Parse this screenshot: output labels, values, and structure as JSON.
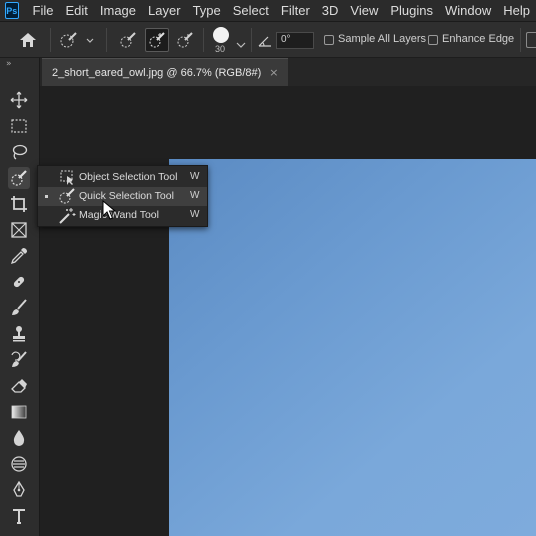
{
  "app": {
    "logo": "Ps"
  },
  "menu": [
    "File",
    "Edit",
    "Image",
    "Layer",
    "Type",
    "Select",
    "Filter",
    "3D",
    "View",
    "Plugins",
    "Window",
    "Help"
  ],
  "options": {
    "brush_size": "30",
    "angle": "0°",
    "sample_all_layers": "Sample All Layers",
    "enhance_edge": "Enhance Edge"
  },
  "toolbar": {
    "collapse": "»"
  },
  "document": {
    "tab_title": "2_short_eared_owl.jpg @ 66.7% (RGB/8#)",
    "close": "×"
  },
  "flyout": {
    "items": [
      {
        "label": "Object Selection Tool",
        "shortcut": "W",
        "icon": "object-selection-icon"
      },
      {
        "label": "Quick Selection Tool",
        "shortcut": "W",
        "icon": "quick-selection-icon",
        "active": true
      },
      {
        "label": "Magic Wand Tool",
        "shortcut": "W",
        "icon": "magic-wand-icon"
      }
    ]
  },
  "colors": {
    "accent": "#31a8ff",
    "canvas_sky": "#6a9ad0",
    "panel": "#2d2d2d"
  }
}
